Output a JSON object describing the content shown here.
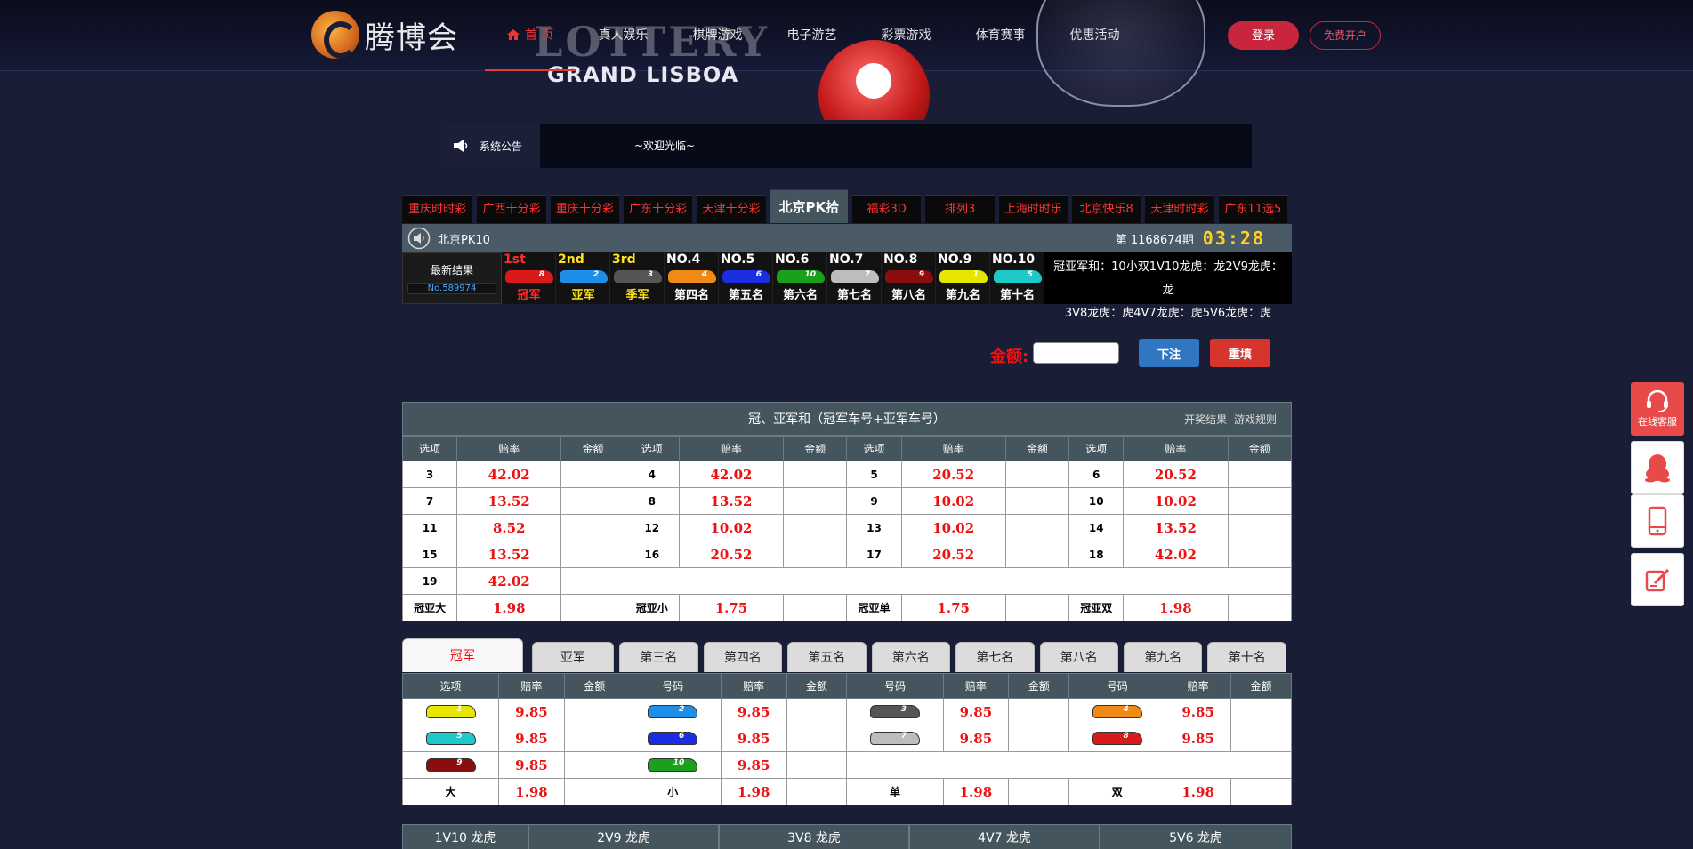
{
  "header": {
    "logo_text": "腾博会",
    "banner_title": "LOTTERY",
    "banner_subtitle": "GRAND LISBOA",
    "nav": [
      {
        "label": "首 页",
        "active": true
      },
      {
        "label": "真人娱乐",
        "active": false
      },
      {
        "label": "棋牌游戏",
        "active": false
      },
      {
        "label": "电子游艺",
        "active": false
      },
      {
        "label": "彩票游戏",
        "active": false
      },
      {
        "label": "体育赛事",
        "active": false
      },
      {
        "label": "优惠活动",
        "active": false
      }
    ],
    "login_label": "登录",
    "register_label": "免费开户"
  },
  "notice": {
    "label": "系统公告",
    "text": "~欢迎光临~"
  },
  "game_tabs": [
    {
      "label": "重庆时时彩",
      "w": 80
    },
    {
      "label": "广西十分彩",
      "w": 78
    },
    {
      "label": "重庆十分彩",
      "w": 78
    },
    {
      "label": "广东十分彩",
      "w": 78
    },
    {
      "label": "天津十分彩",
      "w": 78
    },
    {
      "label": "北京PK拾",
      "w": 88,
      "active": true
    },
    {
      "label": "福彩3D",
      "w": 78
    },
    {
      "label": "排列3",
      "w": 78
    },
    {
      "label": "上海时时乐",
      "w": 78
    },
    {
      "label": "北京快乐8",
      "w": 78
    },
    {
      "label": "天津时时彩",
      "w": 78
    },
    {
      "label": "广东11选5",
      "w": 78
    }
  ],
  "pk": {
    "name": "北京PK10",
    "period": "第 1168674期",
    "countdown": "03:28",
    "latest_label": "最新结果",
    "latest_no": "No.589974",
    "places": [
      {
        "rank": "1st",
        "car": 8,
        "label": "冠军",
        "rank_color": "#ff2d2d",
        "label_color": "#ff2d2d"
      },
      {
        "rank": "2nd",
        "car": 2,
        "label": "亚军",
        "rank_color": "#ffe21a",
        "label_color": "#ffe21a"
      },
      {
        "rank": "3rd",
        "car": 3,
        "label": "季军",
        "rank_color": "#ffe21a",
        "label_color": "#ffe21a"
      },
      {
        "rank": "NO.4",
        "car": 4,
        "label": "第四名",
        "rank_color": "#ffffff",
        "label_color": "#ffffff"
      },
      {
        "rank": "NO.5",
        "car": 6,
        "label": "第五名",
        "rank_color": "#ffffff",
        "label_color": "#ffffff"
      },
      {
        "rank": "NO.6",
        "car": 10,
        "label": "第六名",
        "rank_color": "#ffffff",
        "label_color": "#ffffff"
      },
      {
        "rank": "NO.7",
        "car": 7,
        "label": "第七名",
        "rank_color": "#ffffff",
        "label_color": "#ffffff"
      },
      {
        "rank": "NO.8",
        "car": 9,
        "label": "第八名",
        "rank_color": "#ffffff",
        "label_color": "#ffffff"
      },
      {
        "rank": "NO.9",
        "car": 1,
        "label": "第九名",
        "rank_color": "#ffffff",
        "label_color": "#ffffff"
      },
      {
        "rank": "NO.10",
        "car": 5,
        "label": "第十名",
        "rank_color": "#ffffff",
        "label_color": "#ffffff"
      }
    ],
    "summary_line1": "冠亚军和：10小双1V10龙虎：龙2V9龙虎：龙",
    "summary_line2": "3V8龙虎：虎4V7龙虎：虎5V6龙虎：虎"
  },
  "car_colors": {
    "1": "#e6e600",
    "2": "#1e8fe8",
    "3": "#555555",
    "4": "#f08a16",
    "5": "#1fc9c9",
    "6": "#1a2de0",
    "7": "#bdbdbd",
    "8": "#d81a1a",
    "9": "#8b0e0e",
    "10": "#1aa01a"
  },
  "amount": {
    "label": "金额:",
    "value": "",
    "bet_label": "下注",
    "reset_label": "重填"
  },
  "sum_table": {
    "title": "冠、亚军和（冠军车号+亚军车号）",
    "link1": "开奖结果",
    "link2": "游戏规则",
    "headers": [
      "选项",
      "赔率",
      "金额"
    ],
    "rows": [
      [
        [
          "3",
          "42.02"
        ],
        [
          "4",
          "42.02"
        ],
        [
          "5",
          "20.52"
        ],
        [
          "6",
          "20.52"
        ]
      ],
      [
        [
          "7",
          "13.52"
        ],
        [
          "8",
          "13.52"
        ],
        [
          "9",
          "10.02"
        ],
        [
          "10",
          "10.02"
        ]
      ],
      [
        [
          "11",
          "8.52"
        ],
        [
          "12",
          "10.02"
        ],
        [
          "13",
          "10.02"
        ],
        [
          "14",
          "13.52"
        ]
      ],
      [
        [
          "15",
          "13.52"
        ],
        [
          "16",
          "20.52"
        ],
        [
          "17",
          "20.52"
        ],
        [
          "18",
          "42.02"
        ]
      ],
      [
        [
          "19",
          "42.02"
        ]
      ],
      [
        [
          "冠亚大",
          "1.98"
        ],
        [
          "冠亚小",
          "1.75"
        ],
        [
          "冠亚单",
          "1.75"
        ],
        [
          "冠亚双",
          "1.98"
        ]
      ]
    ]
  },
  "position_tabs": [
    {
      "label": "冠军",
      "w": 130,
      "active": true
    },
    {
      "label": "亚军",
      "w": 90
    },
    {
      "label": "第三名",
      "w": 90
    },
    {
      "label": "第四名",
      "w": 90
    },
    {
      "label": "第五名",
      "w": 90
    },
    {
      "label": "第六名",
      "w": 90
    },
    {
      "label": "第七名",
      "w": 90
    },
    {
      "label": "第八名",
      "w": 90
    },
    {
      "label": "第九名",
      "w": 90
    },
    {
      "label": "第十名",
      "w": 90
    }
  ],
  "position_table": {
    "headers": [
      "选项",
      "赔率",
      "金额",
      "号码",
      "赔率",
      "金额",
      "号码",
      "赔率",
      "金额",
      "号码",
      "赔率",
      "金额"
    ],
    "rows": [
      [
        {
          "car": 1,
          "odds": "9.85"
        },
        {
          "car": 2,
          "odds": "9.85"
        },
        {
          "car": 3,
          "odds": "9.85"
        },
        {
          "car": 4,
          "odds": "9.85"
        }
      ],
      [
        {
          "car": 5,
          "odds": "9.85"
        },
        {
          "car": 6,
          "odds": "9.85"
        },
        {
          "car": 7,
          "odds": "9.85"
        },
        {
          "car": 8,
          "odds": "9.85"
        }
      ],
      [
        {
          "car": 9,
          "odds": "9.85"
        },
        {
          "car": 10,
          "odds": "9.85"
        }
      ],
      [
        {
          "text": "大",
          "odds": "1.98"
        },
        {
          "text": "小",
          "odds": "1.98"
        },
        {
          "text": "单",
          "odds": "1.98"
        },
        {
          "text": "双",
          "odds": "1.98"
        }
      ]
    ]
  },
  "dragon_tiger": [
    "1V10 龙虎",
    "2V9 龙虎",
    "3V8 龙虎",
    "4V7 龙虎",
    "5V6 龙虎"
  ],
  "side": {
    "cs_label": "在线客服"
  }
}
